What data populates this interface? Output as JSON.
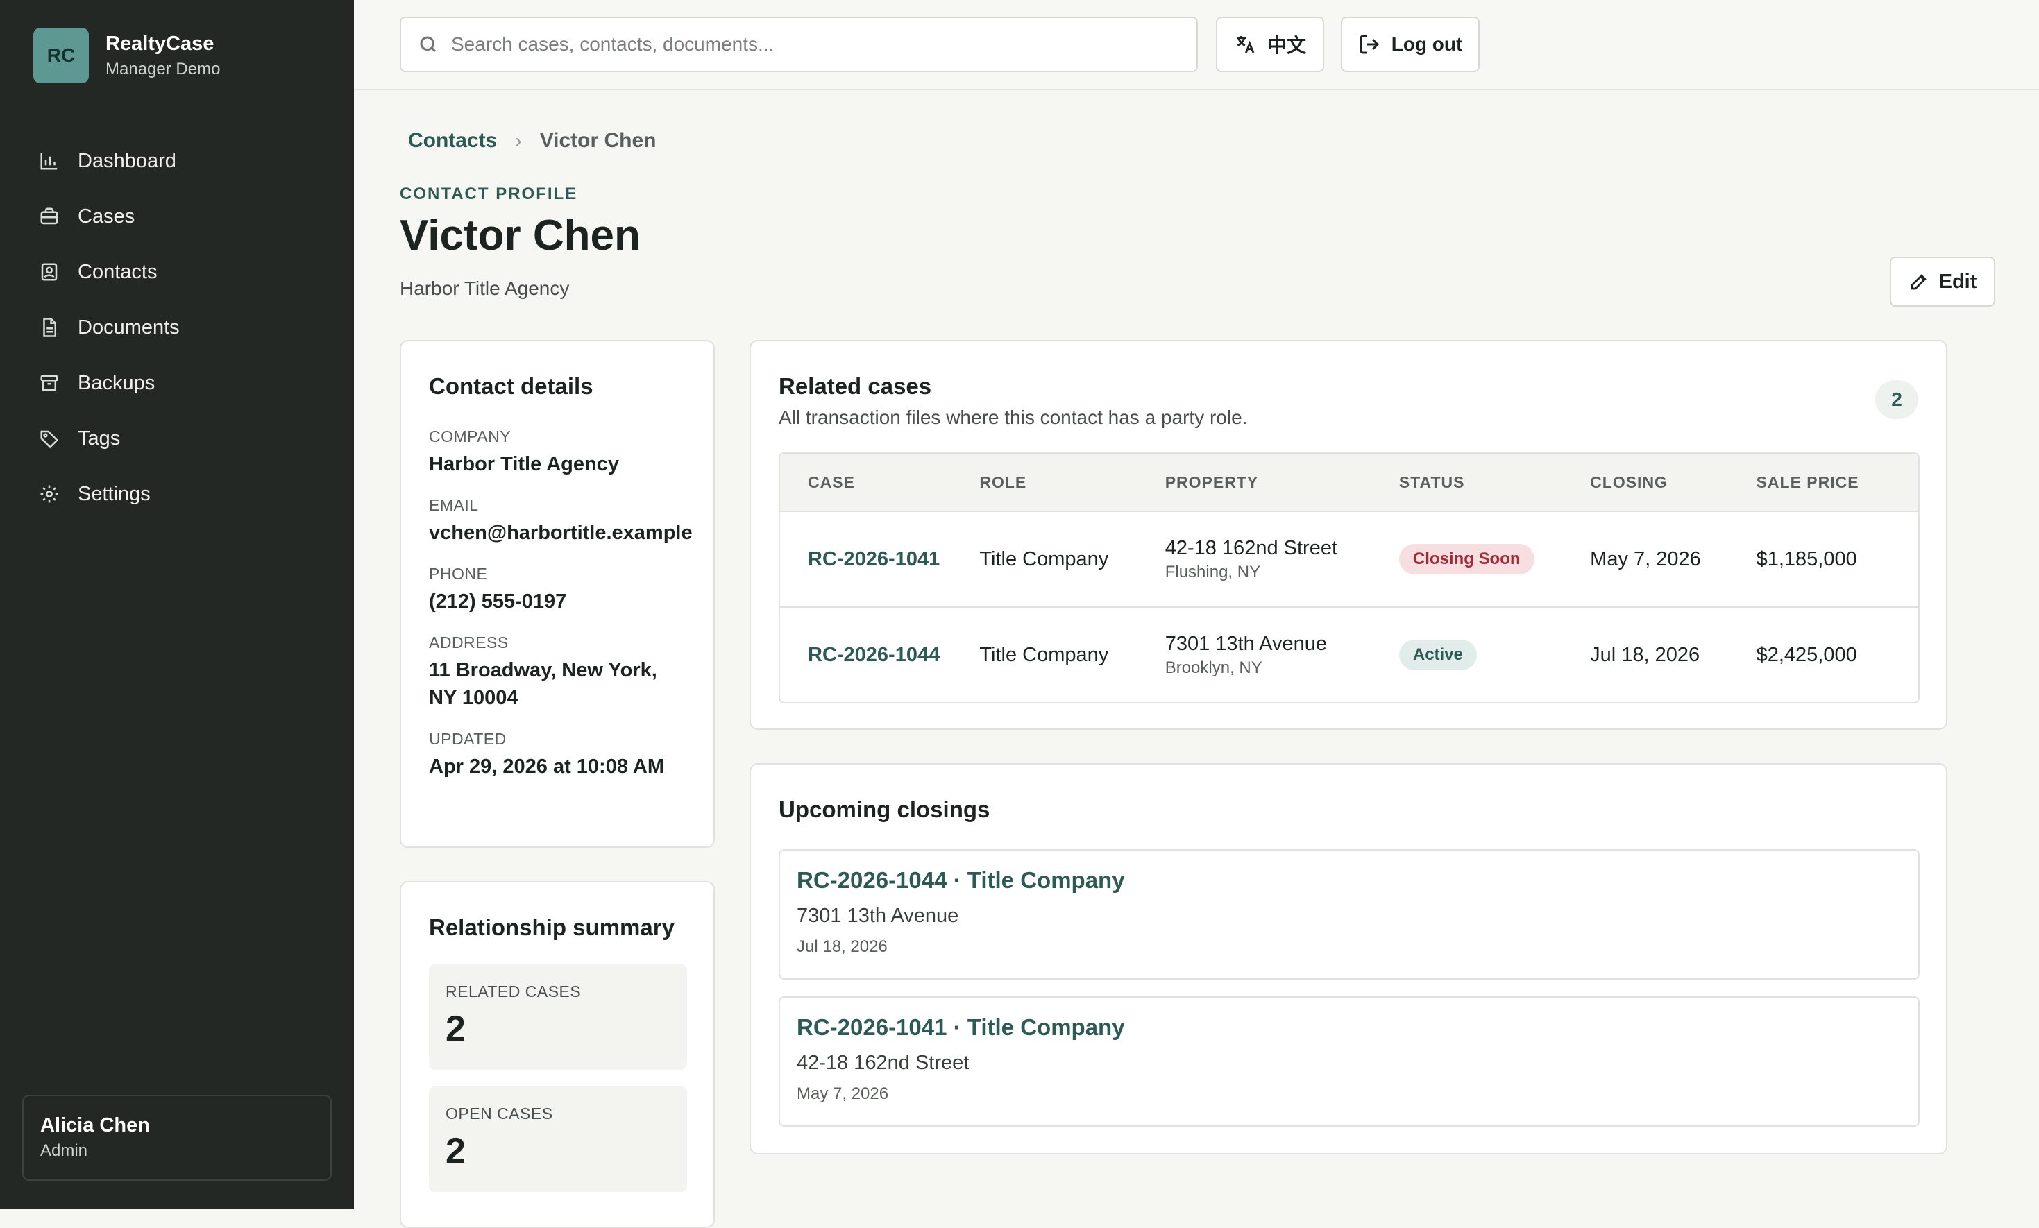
{
  "brand": {
    "initials": "RC",
    "name": "RealtyCase",
    "subtitle": "Manager Demo"
  },
  "nav": [
    {
      "label": "Dashboard",
      "icon": "chart-icon"
    },
    {
      "label": "Cases",
      "icon": "briefcase-icon"
    },
    {
      "label": "Contacts",
      "icon": "contact-icon"
    },
    {
      "label": "Documents",
      "icon": "document-icon"
    },
    {
      "label": "Backups",
      "icon": "archive-icon"
    },
    {
      "label": "Tags",
      "icon": "tag-icon"
    },
    {
      "label": "Settings",
      "icon": "gear-icon"
    }
  ],
  "user": {
    "name": "Alicia Chen",
    "role": "Admin"
  },
  "topbar": {
    "search_placeholder": "Search cases, contacts, documents...",
    "language_label": "中文",
    "logout_label": "Log out"
  },
  "breadcrumb": {
    "parent": "Contacts",
    "current": "Victor Chen"
  },
  "profile": {
    "eyebrow": "CONTACT PROFILE",
    "name": "Victor Chen",
    "company": "Harbor Title Agency",
    "edit_label": "Edit"
  },
  "contact_details": {
    "title": "Contact details",
    "fields": [
      {
        "label": "COMPANY",
        "value": "Harbor Title Agency"
      },
      {
        "label": "EMAIL",
        "value": "vchen@harbortitle.example"
      },
      {
        "label": "PHONE",
        "value": "(212) 555-0197"
      },
      {
        "label": "ADDRESS",
        "value": "11 Broadway, New York, NY 10004"
      },
      {
        "label": "UPDATED",
        "value": "Apr 29, 2026 at 10:08 AM"
      }
    ]
  },
  "relationship_summary": {
    "title": "Relationship summary",
    "stats": [
      {
        "label": "RELATED CASES",
        "value": "2"
      },
      {
        "label": "OPEN CASES",
        "value": "2"
      }
    ]
  },
  "related_cases": {
    "title": "Related cases",
    "subtitle": "All transaction files where this contact has a party role.",
    "count": "2",
    "columns": [
      "CASE",
      "ROLE",
      "PROPERTY",
      "STATUS",
      "CLOSING",
      "SALE PRICE"
    ],
    "rows": [
      {
        "case": "RC-2026-1041",
        "role": "Title Company",
        "property": "42-18 162nd Street",
        "city": "Flushing, NY",
        "status": "Closing Soon",
        "closing": "May 7, 2026",
        "price": "$1,185,000"
      },
      {
        "case": "RC-2026-1044",
        "role": "Title Company",
        "property": "7301 13th Avenue",
        "city": "Brooklyn, NY",
        "status": "Active",
        "closing": "Jul 18, 2026",
        "price": "$2,425,000"
      }
    ]
  },
  "upcoming_closings": {
    "title": "Upcoming closings",
    "items": [
      {
        "title": "RC-2026-1044 · Title Company",
        "address": "7301 13th Avenue",
        "date": "Jul 18, 2026"
      },
      {
        "title": "RC-2026-1041 · Title Company",
        "address": "42-18 162nd Street",
        "date": "May 7, 2026"
      }
    ]
  },
  "colors": {
    "sidebar": "#232824",
    "accent": "#2c5a55",
    "logo": "#5d9892",
    "closing_soon": "#a12a36"
  }
}
